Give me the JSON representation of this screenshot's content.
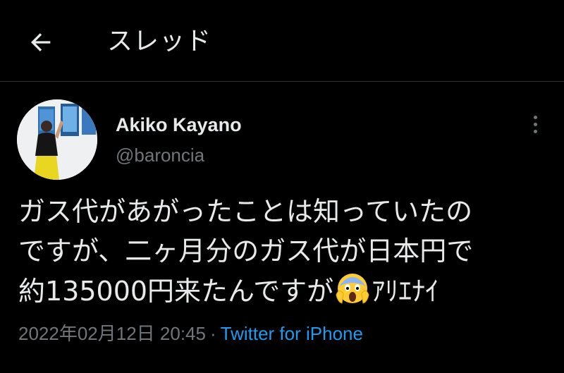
{
  "header": {
    "back_icon": "arrow-left-icon",
    "title": "スレッド"
  },
  "tweet": {
    "author": {
      "display_name": "Akiko Kayano",
      "username": "@baroncia"
    },
    "more_icon": "more-vertical-icon",
    "text_lines": [
      "ガス代があがったことは知っていたの",
      "ですが、二ヶ月分のガス代が日本円で",
      "約135000円来たんですが"
    ],
    "emoji": "face-screaming-in-fear",
    "text_suffix": "ｱﾘｴﾅｲ",
    "timestamp": "2022年02月12日 20:45",
    "separator": "·",
    "source": "Twitter for iPhone"
  },
  "colors": {
    "background": "#000000",
    "text": "#e7e9ea",
    "secondary": "#71767b",
    "link": "#1d9bf0",
    "divider": "#2f3336"
  }
}
